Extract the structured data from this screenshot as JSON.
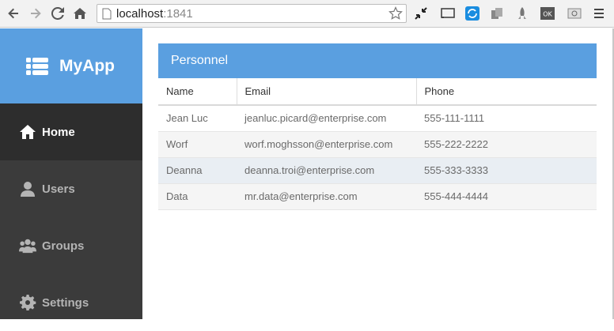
{
  "browser": {
    "url_host": "localhost",
    "url_port": ":1841"
  },
  "app": {
    "brand": "MyApp",
    "nav": [
      {
        "label": "Home",
        "icon": "home-icon",
        "active": true
      },
      {
        "label": "Users",
        "icon": "user-icon",
        "active": false
      },
      {
        "label": "Groups",
        "icon": "users-icon",
        "active": false
      },
      {
        "label": "Settings",
        "icon": "gear-icon",
        "active": false
      }
    ]
  },
  "panel": {
    "title": "Personnel",
    "columns": [
      "Name",
      "Email",
      "Phone"
    ],
    "rows": [
      {
        "name": "Jean Luc",
        "email": "jeanluc.picard@enterprise.com",
        "phone": "555-111-1111"
      },
      {
        "name": "Worf",
        "email": "worf.moghsson@enterprise.com",
        "phone": "555-222-2222"
      },
      {
        "name": "Deanna",
        "email": "deanna.troi@enterprise.com",
        "phone": "555-333-3333"
      },
      {
        "name": "Data",
        "email": "mr.data@enterprise.com",
        "phone": "555-444-4444"
      }
    ]
  },
  "colors": {
    "accent": "#5a9fe0",
    "sidebar": "#3b3b3b",
    "sidebar_active": "#2d2d2d"
  }
}
